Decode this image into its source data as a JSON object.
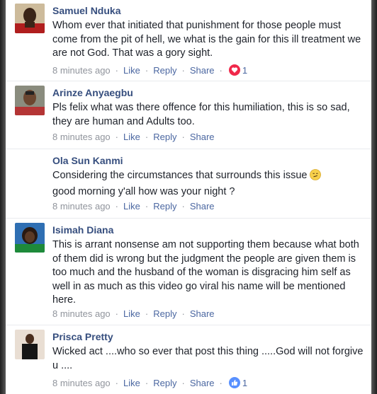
{
  "comments": [
    {
      "name": "Samuel Nduka",
      "text": "Whom ever that initiated that punishment for those people must come from the pit of hell, we what is the gain for this ill treatment we are not God. That was a gory sight.",
      "time": "8 minutes ago",
      "like": "Like",
      "reply": "Reply",
      "share": "Share",
      "reaction": "heart",
      "reaction_count": "1"
    },
    {
      "name": "Arinze Anyaegbu",
      "text": "Pls felix what was there offence for this humiliation, this is so sad, they are human and Adults too.",
      "time": "8 minutes ago",
      "like": "Like",
      "reply": "Reply",
      "share": "Share"
    },
    {
      "name": "Ola Sun Kanmi",
      "text": "Considering the circumstances that surrounds this issue",
      "text2": "good morning y'all how was your night ?",
      "emoji": "smirk-emoji",
      "time": "8 minutes ago",
      "like": "Like",
      "reply": "Reply",
      "share": "Share"
    },
    {
      "name": "Isimah Diana",
      "text": "This is arrant nonsense am not supporting them because what both of them did is wrong but the judgment the people are given them is too much and the husband of the woman is disgracing him self as well in as much as this video go viral his name will be mentioned here.",
      "time": "8 minutes ago",
      "like": "Like",
      "reply": "Reply",
      "share": "Share"
    },
    {
      "name": "Prisca Pretty",
      "text": "Wicked act ....who so ever that post this thing .....God will not forgive u ....",
      "time": "8 minutes ago",
      "like": "Like",
      "reply": "Reply",
      "share": "Share",
      "reaction": "thumbs-up",
      "reaction_count": "1"
    }
  ],
  "colors": {
    "name": "#364e7e",
    "link": "#4b67a1",
    "meta": "#90949c",
    "heart": "#f0284a",
    "like": "#5890ff"
  }
}
